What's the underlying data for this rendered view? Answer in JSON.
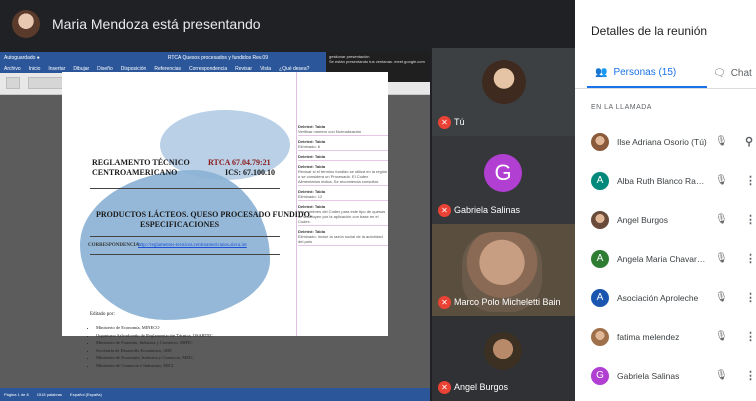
{
  "presenter": {
    "label": "Maria Mendoza está presentando"
  },
  "word": {
    "title": "RTCA Quesos procesados y fundidos Rev.09",
    "menu": [
      "Archivo",
      "Inicio",
      "Insertar",
      "Dibujar",
      "Diseño",
      "Disposición",
      "Referencias",
      "Correspondencia",
      "Revisar",
      "Vista",
      "¿Qué desea?"
    ],
    "notify_title": "gestionar presentación",
    "notify_body": "Se están presentando tus ventanas. meet.google.com",
    "status": [
      "Página 1 de 8",
      "1518 palabras",
      "Español (España)"
    ],
    "doc": {
      "line1": "REGLAMENTO TÉCNICO",
      "line2": "CENTROAMERICANO",
      "code": "RTCA 67.04.79:21",
      "ics": "ICS: 67.100.10",
      "product1": "PRODUCTOS LÁCTEOS. QUESO PROCESADO FUNDIDO.",
      "product2": "ESPECIFICACIONES",
      "corr_label": "CORRESPONDENCIA:",
      "corr_link": "http://reglamentos-tecnicos.centroamericanos.sieca.int",
      "edited_by": "Editado por:",
      "list": [
        "Ministerio de Economía, MINECO",
        "Organismo Salvadoreño de Reglamentación Técnica, OSARTEC",
        "Ministerio de Fomento, Industria y Comercio, MIFIC",
        "Secretaría de Desarrollo Económico, SDE",
        "Ministerio de Economía, Industria y Comercio, MEIC",
        "Ministerio de Comercio e Industrias, MICI"
      ]
    },
    "comments": [
      {
        "h": "Deleted: Tabla",
        "t": "Verificar número con Normalización"
      },
      {
        "h": "Deleted: Tabla",
        "t": "Eliminado: 6"
      },
      {
        "h": "Deleted: Tabla",
        "t": ""
      },
      {
        "h": "Deleted: Tabla",
        "t": "Revisar si el término fundido se utiliza en la región o se considera un Procesado. El Codex Alimentarius indica. Se recomienda consultar."
      },
      {
        "h": "Deleted: Tabla",
        "t": "Eliminado: 12"
      },
      {
        "h": "Deleted: Tabla",
        "t": "Los nombres del Codex para este tipo de quesos se sustituyen por la aplicación con base en el Codex."
      },
      {
        "h": "Deleted: Tabla",
        "t": "Eliminado: Incluir la razón social de la autoridad del país"
      }
    ]
  },
  "tiles": [
    {
      "name": "Tú"
    },
    {
      "name": "Gabriela Salinas",
      "initial": "G"
    },
    {
      "name": "Marco Polo Micheletti Bain"
    },
    {
      "name": "Angel Burgos"
    }
  ],
  "panel": {
    "title": "Detalles de la reunión",
    "tab_people": "Personas (15)",
    "tab_chat": "Chat",
    "section": "EN LA LLAMADA",
    "participants": [
      {
        "name": "Ilse Adriana Osorio (Tú)",
        "initial": "",
        "color": "#8a5a3a",
        "photo": true
      },
      {
        "name": "Alba Ruth Blanco Rauda...",
        "initial": "A",
        "color": "#00897b"
      },
      {
        "name": "Angel Burgos",
        "initial": "",
        "color": "#6a4a3a",
        "photo": true
      },
      {
        "name": "Angela Maria Chavarria ...",
        "initial": "A",
        "color": "#2e7d32"
      },
      {
        "name": "Asociación Aproleche",
        "initial": "A",
        "color": "#1a56b0"
      },
      {
        "name": "fatima melendez",
        "initial": "",
        "color": "#a0704a",
        "photo": true
      },
      {
        "name": "Gabriela Salinas",
        "initial": "G",
        "color": "#b13fd2"
      }
    ]
  }
}
